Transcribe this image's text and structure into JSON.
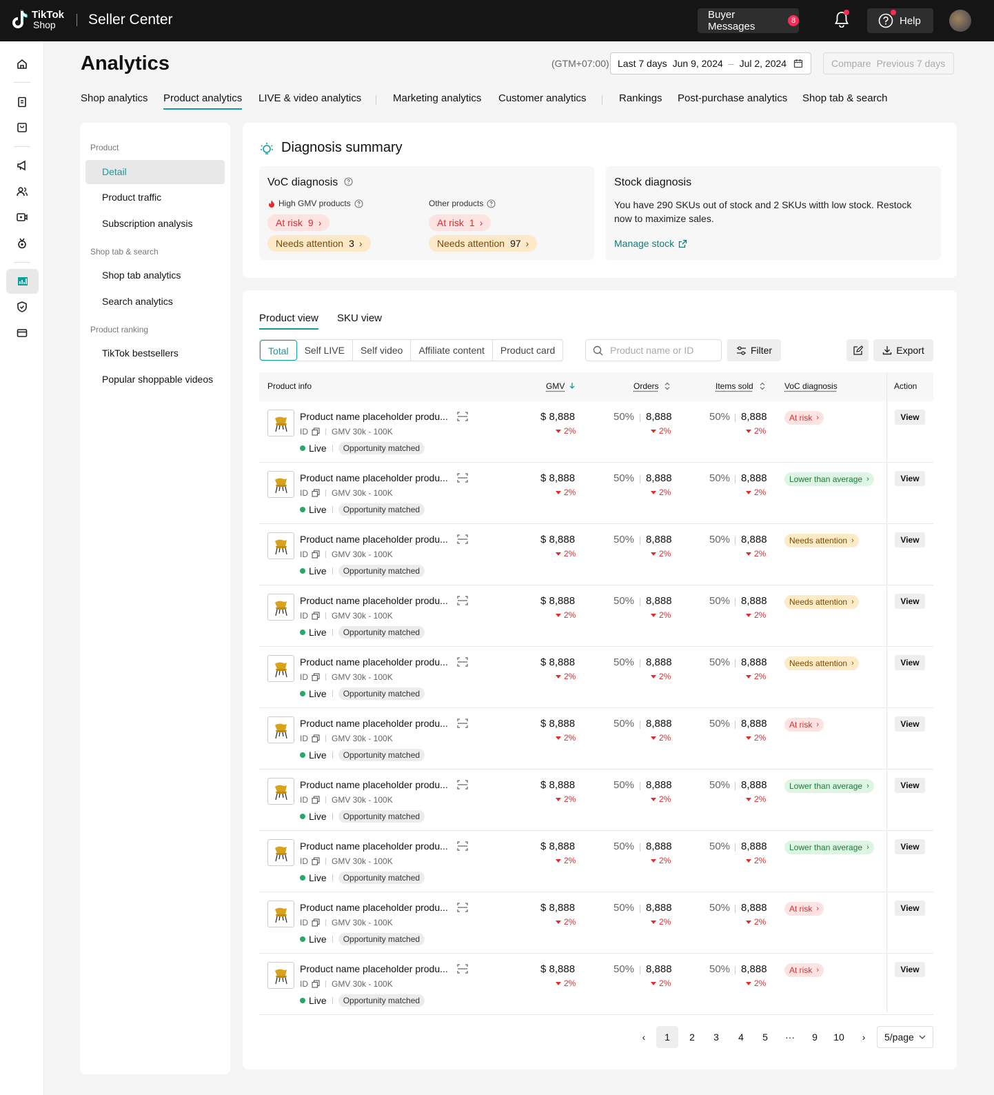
{
  "header": {
    "logo_line1": "TikTok",
    "logo_line2": "Shop",
    "app_title": "Seller Center",
    "buyer_messages_label": "Buyer Messages",
    "buyer_messages_count": "8",
    "help_label": "Help"
  },
  "page": {
    "title": "Analytics",
    "timezone": "(GTM+07:00)",
    "date_range_label": "Last 7 days",
    "date_start": "Jun 9, 2024",
    "date_end": "Jul 2, 2024",
    "compare_label": "Compare",
    "compare_value": "Previous 7 days"
  },
  "tabs": [
    "Shop analytics",
    "Product analytics",
    "LIVE & video analytics",
    "Marketing analytics",
    "Customer analytics",
    "Rankings",
    "Post-purchase analytics",
    "Shop tab &  search"
  ],
  "active_tab": "Product analytics",
  "sidebar": {
    "group_product": "Product",
    "item_detail": "Detail",
    "item_traffic": "Product traffic",
    "item_subscription": "Subscription analysis",
    "group_shoptab": "Shop tab & search",
    "item_shoptab": "Shop tab analytics",
    "item_search": "Search analytics",
    "group_ranking": "Product ranking",
    "item_bestsellers": "TikTok bestsellers",
    "item_popular": "Popular shoppable videos"
  },
  "diagnosis": {
    "title": "Diagnosis summary",
    "voc_title": "VoC diagnosis",
    "high_gmv_label": "High GMV products",
    "other_label": "Other products",
    "high_at_risk_label": "At risk",
    "high_at_risk_count": "9",
    "high_needs_label": "Needs attention",
    "high_needs_count": "3",
    "other_at_risk_label": "At risk",
    "other_at_risk_count": "1",
    "other_needs_label": "Needs attention",
    "other_needs_count": "97",
    "stock_title": "Stock diagnosis",
    "stock_text": "You have 290 SKUs out of stock and 2 SKUs witth low stock. Restock now to maximize sales.",
    "manage_stock": "Manage stock"
  },
  "table_section": {
    "tab_product": "Product view",
    "tab_sku": "SKU view",
    "segments": [
      "Total",
      "Self LIVE",
      "Self video",
      "Affiliate content",
      "Product card"
    ],
    "search_placeholder": "Product name or ID",
    "filter_label": "Filter",
    "export_label": "Export",
    "columns": {
      "product_info": "Product info",
      "gmv": "GMV",
      "orders": "Orders",
      "items_sold": "Items sold",
      "voc": "VoC diagnosis",
      "action": "Action"
    }
  },
  "rows": [
    {
      "name": "Product name placeholder produ...",
      "id": "ID",
      "gmv_range": "GMV 30k - 100K",
      "status": "Live",
      "tag": "Opportunity matched",
      "gmv": "$ 8,888",
      "gmv_delta": "2%",
      "orders_pct": "50%",
      "orders": "8,888",
      "orders_delta": "2%",
      "items_pct": "50%",
      "items": "8,888",
      "items_delta": "2%",
      "voc": "At risk",
      "voc_type": "risk",
      "action": "View"
    },
    {
      "name": "Product name placeholder produ...",
      "id": "ID",
      "gmv_range": "GMV 30k - 100K",
      "status": "Live",
      "tag": "Opportunity matched",
      "gmv": "$ 8,888",
      "gmv_delta": "2%",
      "orders_pct": "50%",
      "orders": "8,888",
      "orders_delta": "2%",
      "items_pct": "50%",
      "items": "8,888",
      "items_delta": "2%",
      "voc": "Lower than average",
      "voc_type": "low",
      "action": "View"
    },
    {
      "name": "Product name placeholder produ...",
      "id": "ID",
      "gmv_range": "GMV 30k - 100K",
      "status": "Live",
      "tag": "Opportunity matched",
      "gmv": "$ 8,888",
      "gmv_delta": "2%",
      "orders_pct": "50%",
      "orders": "8,888",
      "orders_delta": "2%",
      "items_pct": "50%",
      "items": "8,888",
      "items_delta": "2%",
      "voc": "Needs attention",
      "voc_type": "need",
      "action": "View"
    },
    {
      "name": "Product name placeholder produ...",
      "id": "ID",
      "gmv_range": "GMV 30k - 100K",
      "status": "Live",
      "tag": "Opportunity matched",
      "gmv": "$ 8,888",
      "gmv_delta": "2%",
      "orders_pct": "50%",
      "orders": "8,888",
      "orders_delta": "2%",
      "items_pct": "50%",
      "items": "8,888",
      "items_delta": "2%",
      "voc": "Needs attention",
      "voc_type": "need",
      "action": "View"
    },
    {
      "name": "Product name placeholder produ...",
      "id": "ID",
      "gmv_range": "GMV 30k - 100K",
      "status": "Live",
      "tag": "Opportunity matched",
      "gmv": "$ 8,888",
      "gmv_delta": "2%",
      "orders_pct": "50%",
      "orders": "8,888",
      "orders_delta": "2%",
      "items_pct": "50%",
      "items": "8,888",
      "items_delta": "2%",
      "voc": "Needs attention",
      "voc_type": "need",
      "action": "View"
    },
    {
      "name": "Product name placeholder produ...",
      "id": "ID",
      "gmv_range": "GMV 30k - 100K",
      "status": "Live",
      "tag": "Opportunity matched",
      "gmv": "$ 8,888",
      "gmv_delta": "2%",
      "orders_pct": "50%",
      "orders": "8,888",
      "orders_delta": "2%",
      "items_pct": "50%",
      "items": "8,888",
      "items_delta": "2%",
      "voc": "At risk",
      "voc_type": "risk",
      "action": "View"
    },
    {
      "name": "Product name placeholder produ...",
      "id": "ID",
      "gmv_range": "GMV 30k - 100K",
      "status": "Live",
      "tag": "Opportunity matched",
      "gmv": "$ 8,888",
      "gmv_delta": "2%",
      "orders_pct": "50%",
      "orders": "8,888",
      "orders_delta": "2%",
      "items_pct": "50%",
      "items": "8,888",
      "items_delta": "2%",
      "voc": "Lower than average",
      "voc_type": "low",
      "action": "View"
    },
    {
      "name": "Product name placeholder produ...",
      "id": "ID",
      "gmv_range": "GMV 30k - 100K",
      "status": "Live",
      "tag": "Opportunity matched",
      "gmv": "$ 8,888",
      "gmv_delta": "2%",
      "orders_pct": "50%",
      "orders": "8,888",
      "orders_delta": "2%",
      "items_pct": "50%",
      "items": "8,888",
      "items_delta": "2%",
      "voc": "Lower than average",
      "voc_type": "low",
      "action": "View"
    },
    {
      "name": "Product name placeholder produ...",
      "id": "ID",
      "gmv_range": "GMV 30k - 100K",
      "status": "Live",
      "tag": "Opportunity matched",
      "gmv": "$ 8,888",
      "gmv_delta": "2%",
      "orders_pct": "50%",
      "orders": "8,888",
      "orders_delta": "2%",
      "items_pct": "50%",
      "items": "8,888",
      "items_delta": "2%",
      "voc": "At risk",
      "voc_type": "risk",
      "action": "View"
    },
    {
      "name": "Product name placeholder produ...",
      "id": "ID",
      "gmv_range": "GMV 30k - 100K",
      "status": "Live",
      "tag": "Opportunity matched",
      "gmv": "$ 8,888",
      "gmv_delta": "2%",
      "orders_pct": "50%",
      "orders": "8,888",
      "orders_delta": "2%",
      "items_pct": "50%",
      "items": "8,888",
      "items_delta": "2%",
      "voc": "At risk",
      "voc_type": "risk",
      "action": "View"
    }
  ],
  "pagination": {
    "pages": [
      "1",
      "2",
      "3",
      "4",
      "5",
      "···",
      "9",
      "10"
    ],
    "current": "1",
    "per_page": "5/page"
  },
  "colors": {
    "accent": "#0f9d9d",
    "topbar": "#151515",
    "danger": "#e22b2b",
    "success": "#2aa56b"
  }
}
